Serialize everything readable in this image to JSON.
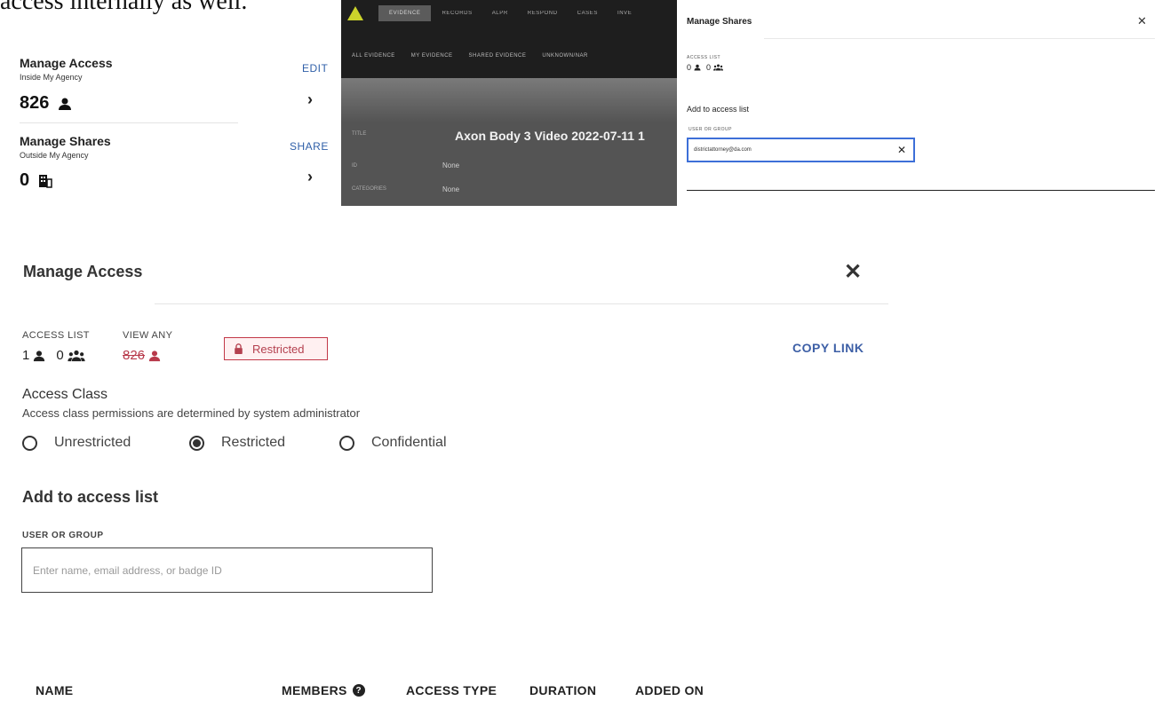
{
  "doc_text": "access internally as well.",
  "panel1": {
    "access_title": "Manage Access",
    "access_sub": "Inside My Agency",
    "access_count": "826",
    "access_action": "EDIT",
    "shares_title": "Manage Shares",
    "shares_sub": "Outside My Agency",
    "shares_count": "0",
    "shares_action": "SHARE"
  },
  "app": {
    "nav": [
      "EVIDENCE",
      "RECORDS",
      "ALPR",
      "RESPOND",
      "CASES",
      "INVE"
    ],
    "subnav": [
      "ALL EVIDENCE",
      "MY EVIDENCE",
      "SHARED EVIDENCE",
      "UNKNOWN/NAR"
    ],
    "fields": [
      {
        "label": "TITLE",
        "value": "Axon Body 3 Video 2022-07-11 1"
      },
      {
        "label": "ID",
        "value": "None"
      },
      {
        "label": "CATEGORIES",
        "value": "None"
      }
    ]
  },
  "shares_panel": {
    "title": "Manage Shares",
    "access_list_label": "ACCESS LIST",
    "user_count": "0",
    "group_count": "0",
    "add_label": "Add to access list",
    "field_label": "USER OR GROUP",
    "field_value": "districtattorney@da.com"
  },
  "manage_access": {
    "title": "Manage Access",
    "access_list_label": "ACCESS LIST",
    "view_any_label": "VIEW ANY",
    "user_count": "1",
    "group_count": "0",
    "view_any_count": "826",
    "badge": "Restricted",
    "copy_link": "COPY LINK",
    "class_title": "Access Class",
    "class_desc": "Access class permissions are determined by system administrator",
    "classes": [
      "Unrestricted",
      "Restricted",
      "Confidential"
    ],
    "selected_class": "Restricted",
    "add_title": "Add to access list",
    "field_label": "USER OR GROUP",
    "field_placeholder": "Enter name, email address, or badge ID",
    "columns": [
      "NAME",
      "MEMBERS",
      "ACCESS TYPE",
      "DURATION",
      "ADDED ON"
    ]
  },
  "colors": {
    "accent": "#3d5fa6",
    "restricted": "#b83a4b",
    "focus": "#3d6fd8",
    "app_dark": "#1e1e1e"
  }
}
